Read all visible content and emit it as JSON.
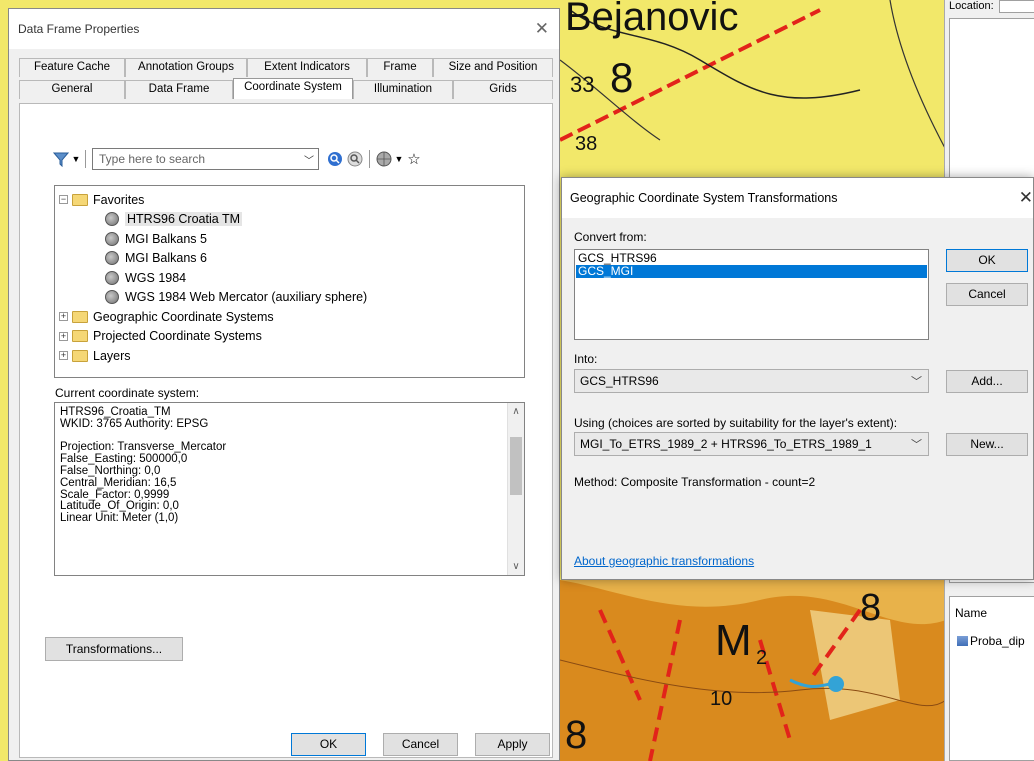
{
  "right_pane": {
    "location_label": "Location:",
    "name_header": "Name",
    "layer_item": "Proba_dip"
  },
  "map_labels": {
    "place": "Bejanovic",
    "num33": "33",
    "num38": "38",
    "num10": "10",
    "m2": "M",
    "m2_sub": "2",
    "eight_a": "8",
    "eight_b": "8",
    "eight_c": "8"
  },
  "dfp": {
    "title": "Data Frame Properties",
    "close_glyph": "✕",
    "tabs_row1": [
      "Feature Cache",
      "Annotation Groups",
      "Extent Indicators",
      "Frame",
      "Size and Position"
    ],
    "tabs_row2": [
      "General",
      "Data Frame",
      "Coordinate System",
      "Illumination",
      "Grids"
    ],
    "active_tab": "Coordinate System",
    "search_placeholder": "Type here to search",
    "tree": {
      "favorites": "Favorites",
      "favorite_items": [
        "HTRS96 Croatia TM",
        "MGI Balkans 5",
        "MGI Balkans 6",
        "WGS 1984",
        "WGS 1984 Web Mercator (auxiliary sphere)"
      ],
      "folders": [
        "Geographic Coordinate Systems",
        "Projected Coordinate Systems",
        "Layers"
      ]
    },
    "current_label": "Current coordinate system:",
    "current_lines": [
      "HTRS96_Croatia_TM",
      "WKID: 3765 Authority: EPSG",
      "",
      "Projection: Transverse_Mercator",
      "False_Easting: 500000,0",
      "False_Northing: 0,0",
      "Central_Meridian: 16,5",
      "Scale_Factor: 0,9999",
      "Latitude_Of_Origin: 0,0",
      "Linear Unit: Meter (1,0)"
    ],
    "transformations_button": "Transformations...",
    "ok": "OK",
    "cancel": "Cancel",
    "apply": "Apply"
  },
  "gcst": {
    "title": "Geographic Coordinate System Transformations",
    "close_glyph": "✕",
    "convert_from_label": "Convert from:",
    "convert_from_items": [
      "GCS_HTRS96",
      "GCS_MGI"
    ],
    "selected_from": "GCS_MGI",
    "into_label": "Into:",
    "into_value": "GCS_HTRS96",
    "using_label": "Using (choices are sorted by suitability for the layer's extent):",
    "using_value": "MGI_To_ETRS_1989_2 + HTRS96_To_ETRS_1989_1",
    "method_text": "Method:   Composite Transformation - count=2",
    "link": "About geographic transformations",
    "ok": "OK",
    "cancel": "Cancel",
    "add": "Add...",
    "new": "New..."
  },
  "colors": {
    "map_yellow": "#f2e86a",
    "map_orange": "#d98a1e",
    "map_red": "#e2231a",
    "accent": "#0078d7"
  }
}
